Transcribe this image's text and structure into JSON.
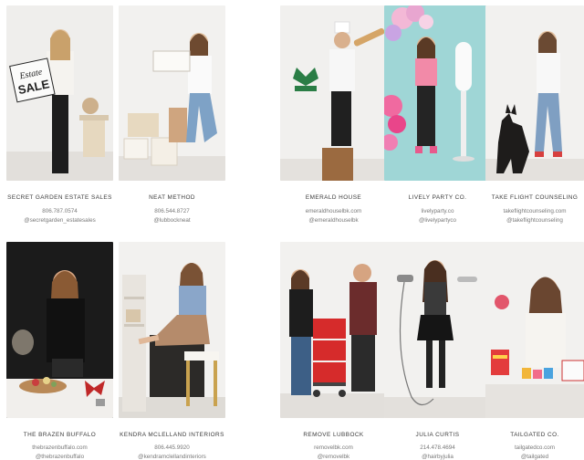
{
  "vendors": [
    {
      "name": "SECRET GARDEN ESTATE SALES",
      "line1": "806.787.0574",
      "line2": "@secretgarden_estatesales",
      "sign_text": [
        "Estate",
        "SALE"
      ]
    },
    {
      "name": "NEAT METHOD",
      "line1": "806.544.8727",
      "line2": "@lubbockneat"
    },
    {
      "name": "EMERALD HOUSE",
      "line1": "emeraldhouselbk.com",
      "line2": "@emeraldhouselbk"
    },
    {
      "name": "LIVELY PARTY CO.",
      "line1": "livelyparty.co",
      "line2": "@livelypartyco"
    },
    {
      "name": "TAKE FLIGHT COUNSELING",
      "line1": "takeflightcounseling.com",
      "line2": "@takeflightcounseling"
    },
    {
      "name": "THE BRAZEN BUFFALO",
      "line1": "thebrazenbuffalo.com",
      "line2": "@thebrazenbuffalo"
    },
    {
      "name": "KENDRA MCLELLAND INTERIORS",
      "line1": "806.445.9920",
      "line2": "@kendramclellandinteriors"
    },
    {
      "name": "REMOVE LUBBOCK",
      "line1": "removelbk.com",
      "line2": "@removelbk"
    },
    {
      "name": "JULIA CURTIS",
      "line1": "214.478.4694",
      "line2": "@hairbyjulia"
    },
    {
      "name": "TAILGATED CO.",
      "line1": "tailgatedco.com",
      "line2": "@tailgated"
    }
  ]
}
